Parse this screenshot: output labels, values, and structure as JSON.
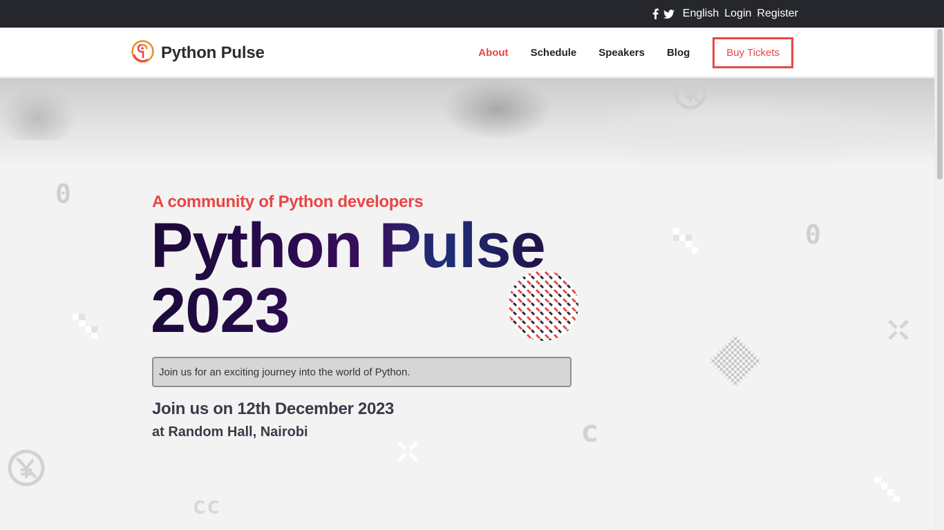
{
  "topbar": {
    "social_icons": [
      "facebook-icon",
      "twitter-icon"
    ],
    "language": "English",
    "login": "Login",
    "register": "Register"
  },
  "brand": {
    "name": "Python Pulse",
    "logo_icon": "python-pulse-logo"
  },
  "nav": {
    "items": [
      {
        "label": "About",
        "active": true
      },
      {
        "label": "Schedule",
        "active": false
      },
      {
        "label": "Speakers",
        "active": false
      },
      {
        "label": "Blog",
        "active": false
      }
    ],
    "cta": "Buy Tickets"
  },
  "hero": {
    "tagline": "A community of Python developers",
    "title_line1": "Python Pulse",
    "title_line2": "2023",
    "description": "Join us for an exciting journey into the world of Python.",
    "date": "Join us on 12th December 2023",
    "venue": "at Random Hall, Nairobi"
  },
  "colors": {
    "accent": "#e84545",
    "topbar_bg": "#25272d",
    "title_dark": "#1b0a3a"
  }
}
